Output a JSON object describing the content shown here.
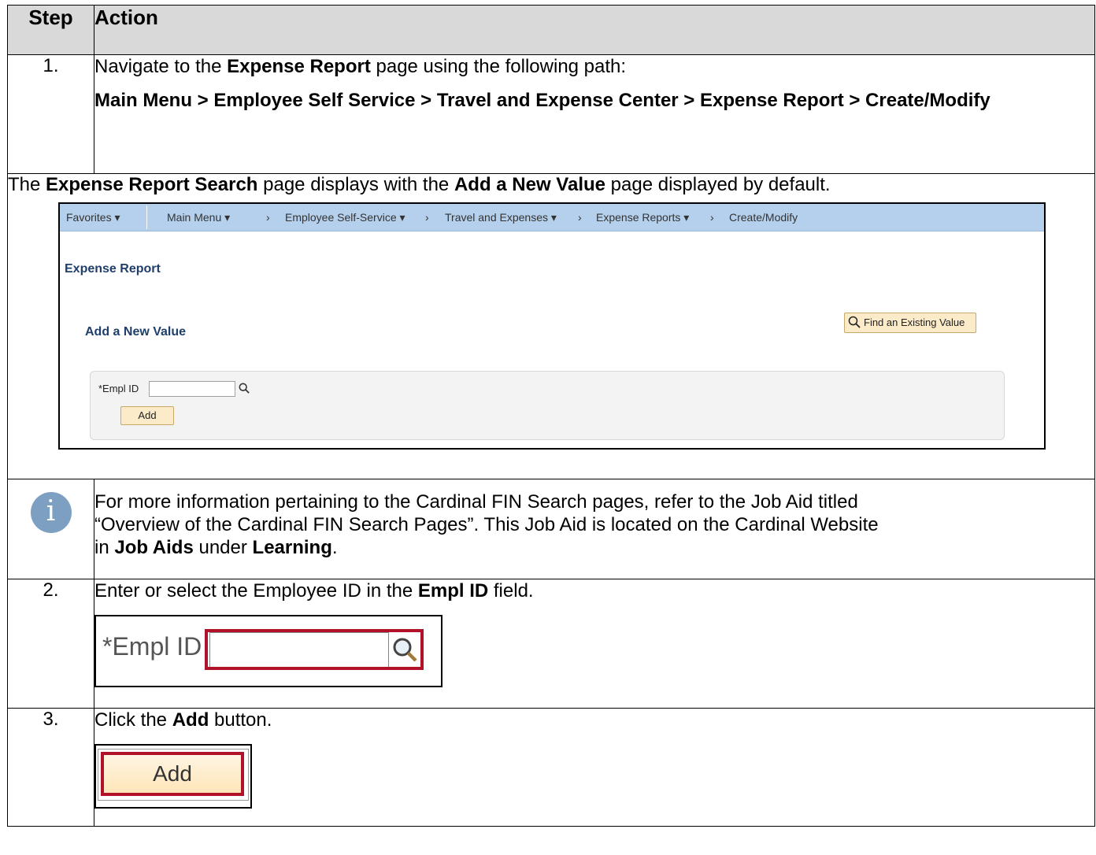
{
  "header": {
    "step": "Step",
    "action": "Action"
  },
  "step1": {
    "num": "1.",
    "line1_pre": "Navigate to the ",
    "line1_bold": "Expense Report",
    "line1_post": " page using the following path:",
    "path": "Main Menu > Employee Self Service > Travel and Expense Center > Expense Report > Create/Modify"
  },
  "note1": {
    "pre": "The ",
    "b1": "Expense Report Search",
    "mid": " page displays with the ",
    "b2": "Add a New Value",
    "post": " page displayed by default."
  },
  "screenshot": {
    "nav": {
      "favorites": "Favorites ▾",
      "main_menu": "Main Menu ▾",
      "sep1": "›",
      "self_service": "Employee Self-Service ▾",
      "sep2": "›",
      "travel": "Travel and Expenses ▾",
      "sep3": "›",
      "reports": "Expense Reports ▾",
      "sep4": "›",
      "create": "Create/Modify"
    },
    "page_title": "Expense Report",
    "sub_title": "Add a New Value",
    "find_btn": "Find an Existing Value",
    "empl_label": "*Empl ID",
    "add_btn": "Add"
  },
  "info": {
    "icon": "info-icon",
    "line1": "For more information pertaining to the Cardinal FIN Search pages, refer to the Job Aid titled",
    "line2": "“Overview of the Cardinal FIN Search Pages”.  This Job Aid is located on the Cardinal Website",
    "line3_pre": "in ",
    "line3_b1": "Job Aids",
    "line3_mid": " under ",
    "line3_b2": "Learning",
    "line3_post": "."
  },
  "step2": {
    "num": "2.",
    "pre": "Enter or select the Employee ID in the ",
    "bold": "Empl ID",
    "post": " field.",
    "crop_label": "*Empl ID"
  },
  "step3": {
    "num": "3.",
    "pre": "Click the ",
    "bold": "Add",
    "post": " button.",
    "crop_btn": "Add"
  },
  "colors": {
    "header_bg": "#d9d9d9",
    "nav_bg": "#b5d0ec",
    "highlight": "#b0122a",
    "button": "#fcebc9",
    "title_blue": "#1f3f6a",
    "info_icon": "#7d9fc2"
  }
}
